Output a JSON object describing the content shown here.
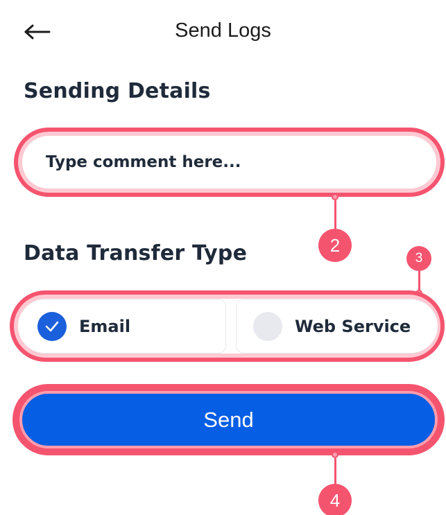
{
  "header": {
    "title": "Send Logs",
    "back_icon": "arrow-left-icon"
  },
  "sending_details": {
    "heading": "Sending Details",
    "comment_placeholder": "Type comment here..."
  },
  "transfer_type": {
    "heading": "Data Transfer Type",
    "options": [
      {
        "label": "Email",
        "selected": true
      },
      {
        "label": "Web Service",
        "selected": false
      }
    ]
  },
  "send_button": {
    "label": "Send"
  },
  "callouts": {
    "comment": "2",
    "transfer": "3",
    "send": "4"
  },
  "colors": {
    "accent": "#055ee4",
    "check": "#1a5fdb",
    "highlight": "#f5546f",
    "heading_text": "#1f2a3a"
  }
}
